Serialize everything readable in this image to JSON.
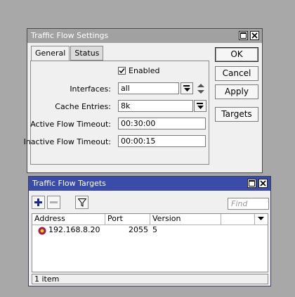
{
  "settings_window": {
    "title": "Traffic Flow Settings",
    "tabs": [
      {
        "label": "General",
        "active": true
      },
      {
        "label": "Status",
        "active": false
      }
    ],
    "enabled": {
      "label": "Enabled",
      "checked": true
    },
    "fields": {
      "interfaces": {
        "label": "Interfaces:",
        "value": "all"
      },
      "cache_entries": {
        "label": "Cache Entries:",
        "value": "8k"
      },
      "active_flow_timeout": {
        "label": "Active Flow Timeout:",
        "value": "00:30:00"
      },
      "inactive_flow_timeout": {
        "label": "Inactive Flow Timeout:",
        "value": "00:00:15"
      }
    },
    "buttons": {
      "ok": "OK",
      "cancel": "Cancel",
      "apply": "Apply",
      "targets": "Targets"
    }
  },
  "targets_window": {
    "title": "Traffic Flow Targets",
    "find_placeholder": "Find",
    "columns": [
      "Address",
      "Port",
      "Version"
    ],
    "rows": [
      {
        "address": "192.168.8.20",
        "port": "2055",
        "version": "5"
      }
    ],
    "status": "1 item"
  },
  "colors": {
    "desktop": "#a8a8a8",
    "settings_titlebar": "#a1a1a1",
    "targets_titlebar": "#3b4ba8",
    "add_icon": "#1a2a9a"
  }
}
